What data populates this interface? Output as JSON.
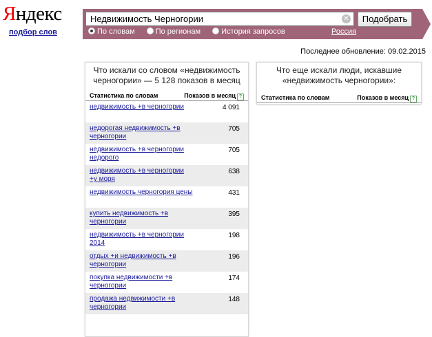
{
  "logo": {
    "first": "Я",
    "rest": "ндекс"
  },
  "sublink": "подбор слов",
  "search": {
    "value": "Недвижимость Черногории",
    "button": "Подобрать"
  },
  "modes": [
    {
      "label": "По словам",
      "checked": true
    },
    {
      "label": "По регионам",
      "checked": false
    },
    {
      "label": "История запросов",
      "checked": false
    }
  ],
  "region": "Россия",
  "last_update": "Последнее обновление: 09.02.2015",
  "left": {
    "title": "Что искали со словом «недвижимость черногории» — 5 128 показов в месяц",
    "col1": "Статистика по словам",
    "col2": "Показов в месяц",
    "rows": [
      {
        "phrase": "недвижимость +в черногории",
        "count": "4 091"
      },
      {
        "phrase": "недорогая недвижимость +в черногории",
        "count": "705"
      },
      {
        "phrase": "недвижимость +в черногории недорого",
        "count": "705"
      },
      {
        "phrase": "недвижимость +в черногории +у моря",
        "count": "638"
      },
      {
        "phrase": "недвижимость черногория цены",
        "count": "431"
      },
      {
        "phrase": "купить недвижимость +в черногории",
        "count": "395"
      },
      {
        "phrase": "недвижимость +в черногории 2014",
        "count": "198"
      },
      {
        "phrase": "отдых +и недвижимость +в черногории",
        "count": "196"
      },
      {
        "phrase": "покупка недвижимости +в черногории",
        "count": "174"
      },
      {
        "phrase": "продажа недвижимости +в черногории",
        "count": "148"
      }
    ]
  },
  "right": {
    "title": "Что еще искали люди, искавшие «недвижимость черногории»:",
    "col1": "Статистика по словам",
    "col2": "Показов в месяц"
  }
}
